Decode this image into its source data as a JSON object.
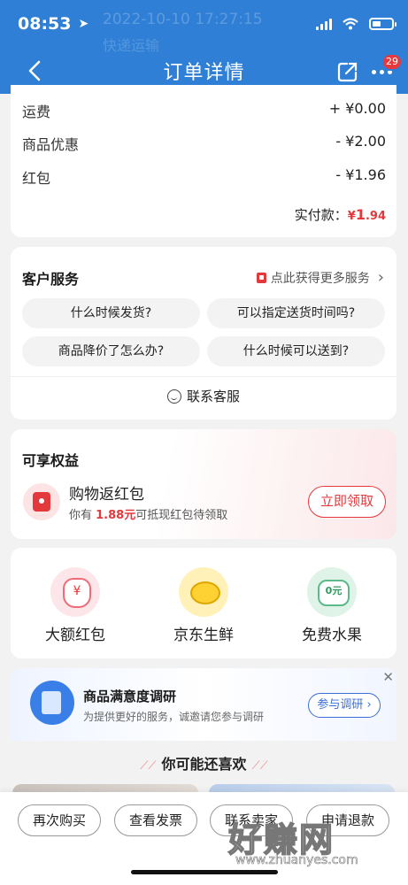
{
  "status_bar": {
    "time": "08:53",
    "ghost_text_1": "2022-10-10 17:27:15",
    "ghost_text_2": "快递运输"
  },
  "nav": {
    "title": "订单详情",
    "badge_count": "29"
  },
  "fees": {
    "rows": [
      {
        "label": "运费",
        "value": "+ ¥0.00"
      },
      {
        "label": "商品优惠",
        "value": "- ¥2.00"
      },
      {
        "label": "红包",
        "value": "- ¥1.96"
      }
    ],
    "paid_label": "实付款：",
    "paid_currency": "¥",
    "paid_int": "1",
    "paid_dec": ".94"
  },
  "service": {
    "title": "客户服务",
    "more_link": "点此获得更多服务",
    "questions": [
      "什么时候发货?",
      "可以指定送货时间吗?",
      "商品降价了怎么办?",
      "什么时候可以送到?"
    ],
    "contact_label": "联系客服"
  },
  "benefits": {
    "title": "可享权益",
    "name": "购物返红包",
    "desc_prefix": "你有 ",
    "desc_amount": "1.88元",
    "desc_suffix": "可抵现红包待领取",
    "claim_button": "立即领取"
  },
  "entries": [
    {
      "label": "大额红包",
      "icon": "red-envelope-bag-icon"
    },
    {
      "label": "京东生鲜",
      "icon": "lemon-icon"
    },
    {
      "label": "免费水果",
      "icon": "free-fruit-tree-icon"
    }
  ],
  "survey": {
    "title": "商品满意度调研",
    "subtitle": "为提供更好的服务，诚邀请您参与调研",
    "button": "参与调研 ›",
    "close": "✕"
  },
  "recommend": {
    "title": "你可能还喜欢"
  },
  "bottom_bar": {
    "buttons": [
      "再次购买",
      "查看发票",
      "联系卖家",
      "申请退款"
    ]
  },
  "watermark": {
    "big": "好赚网",
    "small": "www.zhuanyes.com"
  },
  "colors": {
    "header_blue": "#2f7fd6",
    "price_red": "#e4393c",
    "survey_blue": "#3a6fd8"
  }
}
